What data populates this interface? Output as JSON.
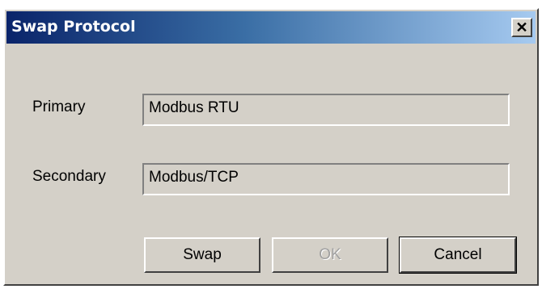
{
  "window": {
    "title": "Swap Protocol",
    "close_glyph": "✕"
  },
  "form": {
    "primary_label": "Primary",
    "primary_value": "Modbus RTU",
    "secondary_label": "Secondary",
    "secondary_value": "Modbus/TCP"
  },
  "buttons": {
    "swap_label": "Swap",
    "ok_label": "OK",
    "cancel_label": "Cancel"
  },
  "colors": {
    "titlebar_start": "#0a246a",
    "titlebar_end": "#a6caf0",
    "dialog_face": "#d4d0c8"
  },
  "icons": {
    "close": "close-icon"
  }
}
